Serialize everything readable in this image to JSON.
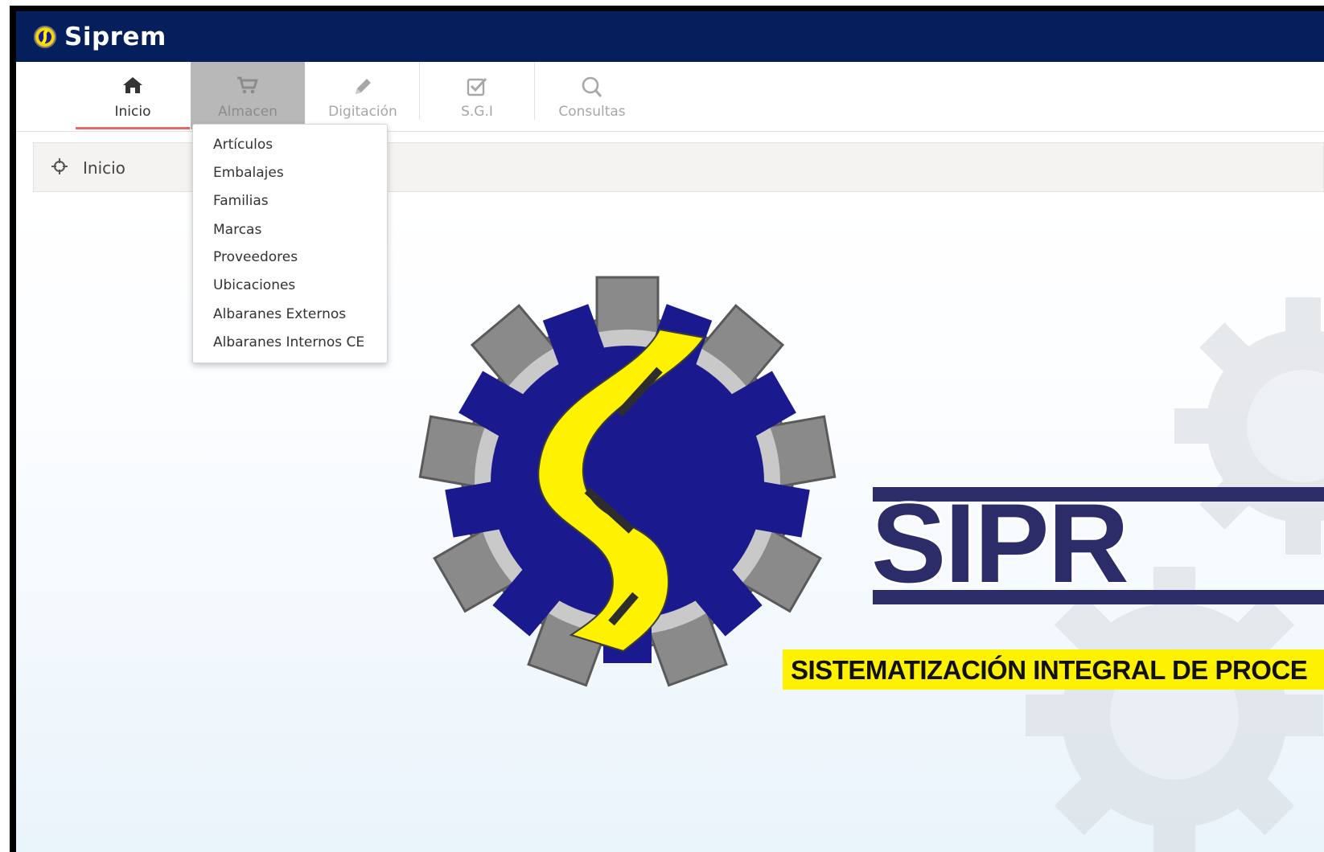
{
  "app": {
    "title": "Siprem"
  },
  "nav": {
    "tabs": [
      {
        "label": "Inicio",
        "icon": "home-icon"
      },
      {
        "label": "Almacen",
        "icon": "cart-icon"
      },
      {
        "label": "Digitación",
        "icon": "pencil-icon"
      },
      {
        "label": "S.G.I",
        "icon": "checkbox-icon"
      },
      {
        "label": "Consultas",
        "icon": "search-icon"
      }
    ],
    "active_tab": "Inicio",
    "open_menu": "Almacen"
  },
  "dropdown": {
    "items": [
      "Artículos",
      "Embalajes",
      "Familias",
      "Marcas",
      "Proveedores",
      "Ubicaciones",
      "Albaranes Externos",
      "Albaranes Internos CE"
    ]
  },
  "breadcrumb": {
    "label": "Inicio",
    "icon": "crosshair-icon"
  },
  "hero": {
    "logo_text": "SIPR",
    "tagline": "SISTEMATIZACIÓN INTEGRAL DE PROCE"
  },
  "colors": {
    "topbar": "#041f5c",
    "active_underline": "#e76666",
    "logo_blue": "#1a1a8e",
    "logo_yellow": "#fff200",
    "logo_navy": "#2c2c68"
  }
}
